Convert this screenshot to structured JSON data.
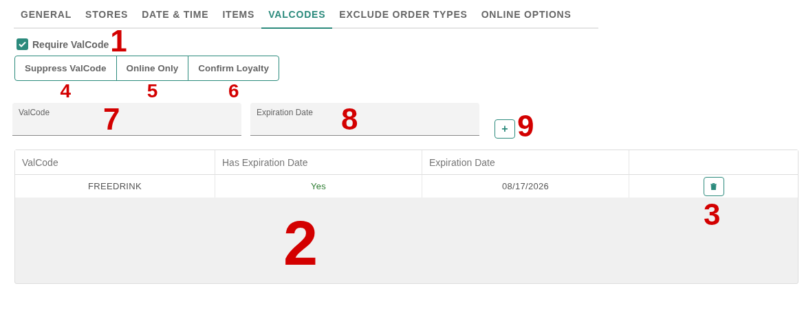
{
  "tabs": [
    {
      "label": "GENERAL",
      "selected": false
    },
    {
      "label": "STORES",
      "selected": false
    },
    {
      "label": "DATE & TIME",
      "selected": false
    },
    {
      "label": "ITEMS",
      "selected": false
    },
    {
      "label": "VALCODES",
      "selected": true
    },
    {
      "label": "EXCLUDE ORDER TYPES",
      "selected": false
    },
    {
      "label": "ONLINE OPTIONS",
      "selected": false
    }
  ],
  "require_valcode": {
    "label": "Require ValCode",
    "checked": true,
    "annotation": "1"
  },
  "option_buttons": [
    {
      "label": "Suppress ValCode",
      "annotation": "4"
    },
    {
      "label": "Online Only",
      "annotation": "5"
    },
    {
      "label": "Confirm Loyalty",
      "annotation": "6"
    }
  ],
  "fields": [
    {
      "label": "ValCode",
      "annotation": "7"
    },
    {
      "label": "Expiration Date",
      "annotation": "8"
    }
  ],
  "add_button": {
    "label": "+",
    "annotation": "9"
  },
  "table": {
    "columns": [
      "ValCode",
      "Has Expiration Date",
      "Expiration Date"
    ],
    "annotation": "2",
    "rows": [
      {
        "valcode": "FREEDRINK",
        "has_expiration": "Yes",
        "expiration_date": "08/17/2026",
        "delete_annotation": "3"
      }
    ]
  }
}
